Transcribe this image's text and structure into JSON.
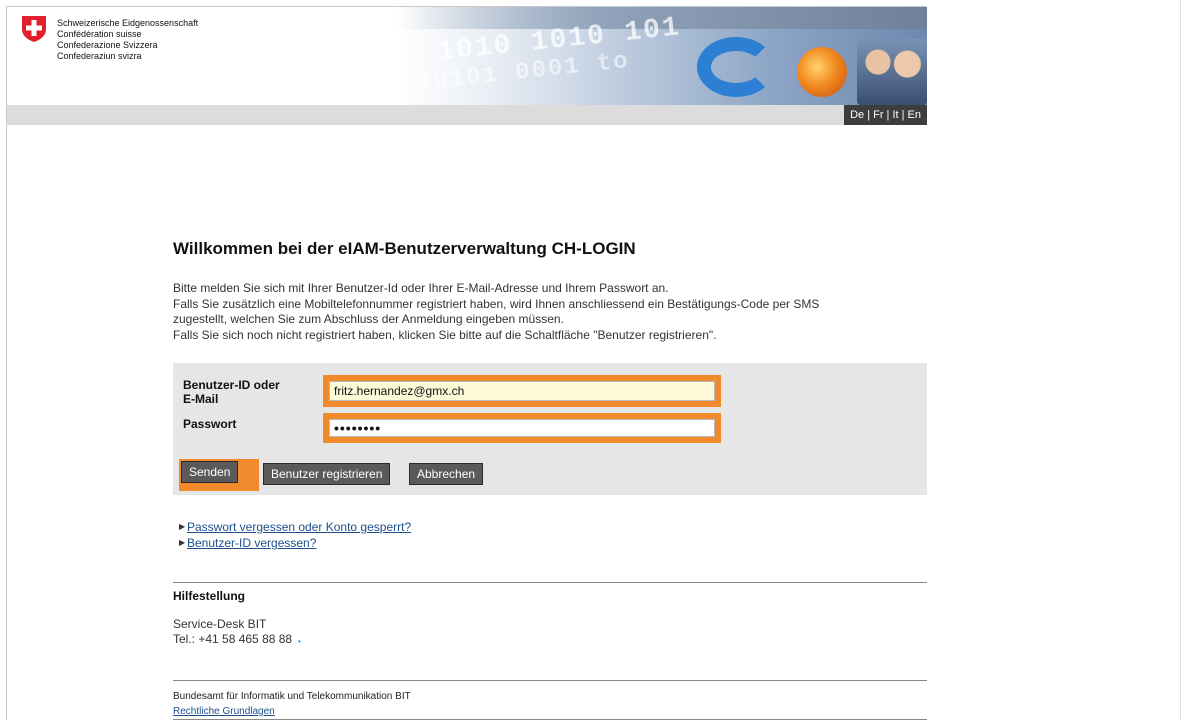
{
  "header": {
    "confederation_names": [
      "Schweizerische Eidgenossenschaft",
      "Confédération suisse",
      "Confederazione Svizzera",
      "Confederaziun svizra"
    ],
    "banner_digits_1": "1010 1010 101",
    "banner_digits_2": "10101 0001 to",
    "language_switch": "De | Fr | It | En"
  },
  "main": {
    "title": "Willkommen bei der eIAM-Benutzerverwaltung CH-LOGIN",
    "intro_lines": [
      "Bitte melden Sie sich mit Ihrer Benutzer-Id oder Ihrer E-Mail-Adresse und Ihrem Passwort an.",
      "Falls Sie zusätzlich eine Mobiltelefonnummer registriert haben, wird Ihnen anschliessend ein Bestätigungs-Code per SMS",
      "zugestellt, welchen Sie zum Abschluss der Anmeldung eingeben müssen.",
      "Falls Sie sich noch nicht registriert haben, klicken Sie bitte auf die Schaltfläche \"Benutzer registrieren\"."
    ]
  },
  "form": {
    "user_label_line1": "Benutzer-ID oder",
    "user_label_line2": "E-Mail",
    "user_value": "fritz.hernandez@gmx.ch",
    "password_label": "Passwort",
    "password_value": "••••••••",
    "send_button": "Senden",
    "register_button": "Benutzer registrieren",
    "cancel_button": "Abbrechen"
  },
  "links": {
    "forgot_password": "Passwort vergessen oder Konto gesperrt?",
    "forgot_userid": "Benutzer-ID vergessen?"
  },
  "help": {
    "title": "Hilfestellung",
    "desk": "Service-Desk BIT",
    "phone": "Tel.: +41 58 465 88 88"
  },
  "footer": {
    "office": "Bundesamt für Informatik und Telekommunikation BIT",
    "legal_link": "Rechtliche Grundlagen"
  },
  "colors": {
    "highlight": "#f08a2c",
    "button": "#5a5a5a",
    "form_bg": "#e6e6e6",
    "link": "#1c4f8c"
  }
}
